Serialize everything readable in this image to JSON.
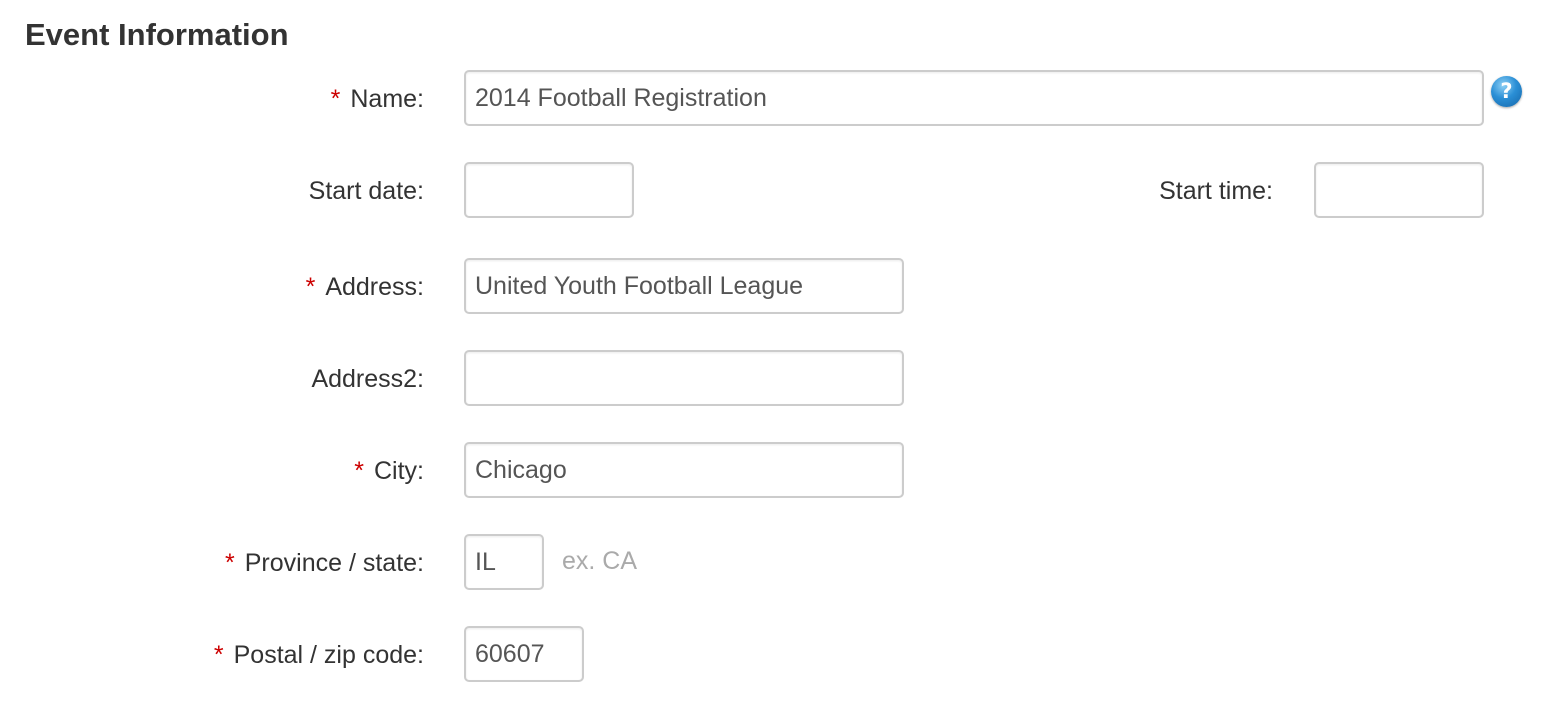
{
  "section": {
    "title": "Event Information"
  },
  "required_marker": "*",
  "help_icon": {
    "glyph": "?",
    "icon": "help-icon"
  },
  "fields": {
    "name": {
      "label": "Name:",
      "value": "2014 Football Registration",
      "required": true
    },
    "start_date": {
      "label": "Start date:",
      "value": "",
      "required": false
    },
    "start_time": {
      "label": "Start time:",
      "value": "",
      "required": false
    },
    "address": {
      "label": "Address:",
      "value": "United Youth Football League",
      "required": true
    },
    "address2": {
      "label": "Address2:",
      "value": "",
      "required": false
    },
    "city": {
      "label": "City:",
      "value": "Chicago",
      "required": true
    },
    "province_state": {
      "label": "Province / state:",
      "value": "IL",
      "hint": "ex. CA",
      "required": true
    },
    "postal_code": {
      "label": "Postal / zip code:",
      "value": "60607",
      "required": true
    }
  },
  "colors": {
    "required": "#cc0000",
    "text": "#333333",
    "field_border": "#cccccc",
    "hint": "#aaaaaa",
    "help_icon": "#2a8fd6"
  }
}
